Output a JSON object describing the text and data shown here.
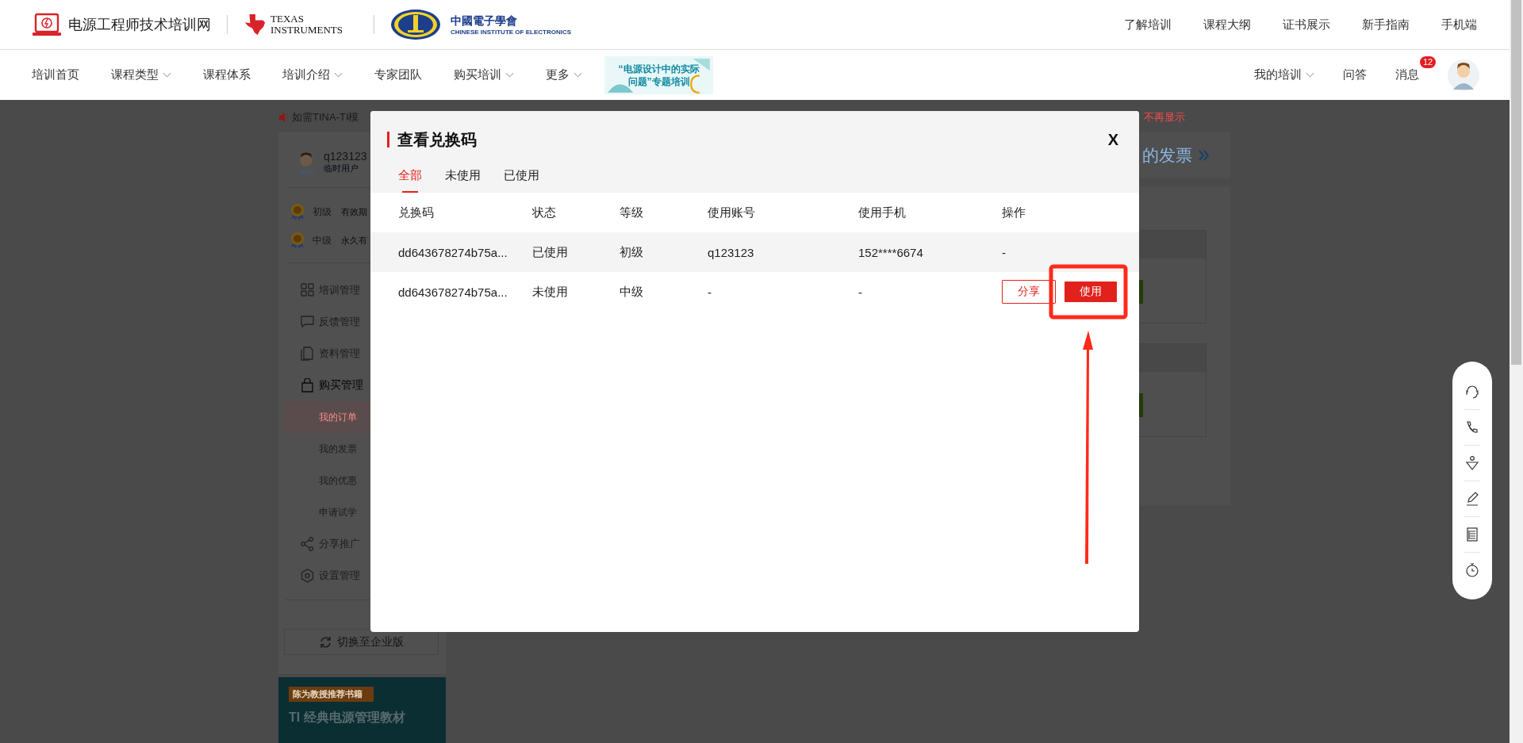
{
  "top_bar": {
    "site_name": "电源工程师技术培训网",
    "partner_wordmark": "TEXAS INSTRUMENTS",
    "society_name": "中國電子學會",
    "society_subtitle": "CHINESE INSTITUTE OF ELECTRONICS",
    "links": [
      "了解培训",
      "课程大纲",
      "证书展示",
      "新手指南",
      "手机端"
    ]
  },
  "nav": {
    "items": [
      {
        "label": "培训首页",
        "has_dropdown": false
      },
      {
        "label": "课程类型",
        "has_dropdown": true
      },
      {
        "label": "课程体系",
        "has_dropdown": false
      },
      {
        "label": "培训介绍",
        "has_dropdown": true
      },
      {
        "label": "专家团队",
        "has_dropdown": false
      },
      {
        "label": "购买培训",
        "has_dropdown": true
      },
      {
        "label": "更多",
        "has_dropdown": true
      }
    ],
    "promo": {
      "line_1": "“电源设计中的实际",
      "line_2": "问题”专题培训"
    },
    "right_items": [
      {
        "label": "我的培训",
        "has_dropdown": true
      },
      {
        "label": "问答",
        "has_dropdown": false
      },
      {
        "label": "消息",
        "has_dropdown": false,
        "badge": "12"
      }
    ]
  },
  "notice": {
    "text": "如需TINA-TI模",
    "dismiss": "不再显示"
  },
  "sidebar": {
    "user": {
      "name": "q123123",
      "role": "临时用户"
    },
    "levels": [
      {
        "name": "初级",
        "note": "有效期"
      },
      {
        "name": "中级",
        "note": "永久有"
      }
    ],
    "menu": [
      {
        "label": "培训管理"
      },
      {
        "label": "反馈管理"
      },
      {
        "label": "资料管理"
      },
      {
        "label": "购买管理",
        "children": [
          {
            "label": "我的订单",
            "selected": true
          },
          {
            "label": "我的发票",
            "selected": false
          },
          {
            "label": "我的优惠",
            "selected": false
          },
          {
            "label": "申请试学",
            "selected": false
          }
        ]
      },
      {
        "label": "分享推广"
      },
      {
        "label": "设置管理"
      }
    ],
    "switch_button": "切换至企业版",
    "ad": {
      "tag": "陈为教授推荐书籍",
      "title": "TI 经典电源管理教材"
    }
  },
  "main": {
    "invoice_link": "的发票"
  },
  "modal": {
    "title": "查看兑换码",
    "close": "X",
    "tabs": [
      {
        "label": "全部",
        "selected": true
      },
      {
        "label": "未使用",
        "selected": false
      },
      {
        "label": "已使用",
        "selected": false
      }
    ],
    "columns": [
      "兑换码",
      "状态",
      "等级",
      "使用账号",
      "使用手机",
      "操作"
    ],
    "rows": [
      {
        "cells": [
          "dd643678274b75a...",
          "已使用",
          "初级",
          "q123123",
          "152****6674"
        ],
        "operation": "-"
      },
      {
        "cells": [
          "dd643678274b75a...",
          "未使用",
          "中级",
          "-",
          "-"
        ],
        "actions": [
          {
            "label": "分享",
            "kind": "outline"
          },
          {
            "label": "使用",
            "kind": "primary"
          }
        ]
      }
    ]
  }
}
